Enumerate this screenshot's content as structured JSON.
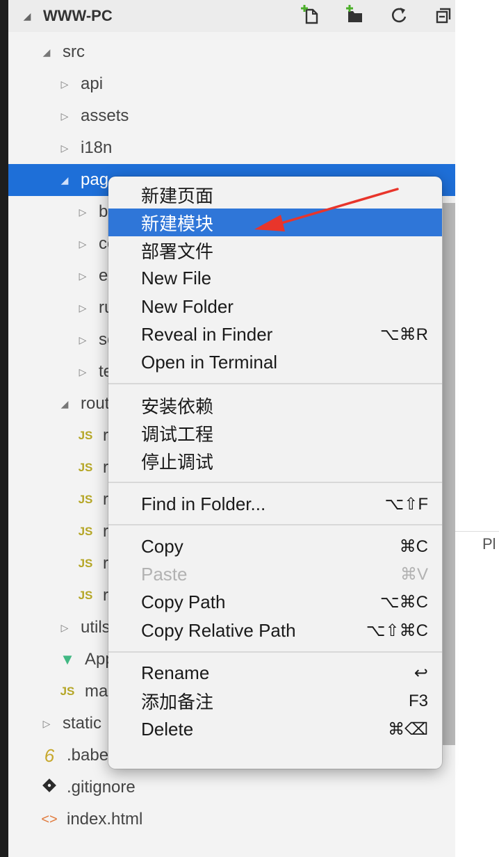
{
  "explorer": {
    "project_title": "WWW-PC",
    "header_icons": [
      "new-file-icon",
      "new-folder-icon",
      "refresh-icon",
      "collapse-all-icon"
    ],
    "tree": [
      {
        "label": "src",
        "twist": "◢",
        "icon": "",
        "depth": 1,
        "selected": false
      },
      {
        "label": "api",
        "twist": "▷",
        "icon": "",
        "depth": 2,
        "selected": false
      },
      {
        "label": "assets",
        "twist": "▷",
        "icon": "",
        "depth": 2,
        "selected": false
      },
      {
        "label": "i18n",
        "twist": "▷",
        "icon": "",
        "depth": 2,
        "selected": false
      },
      {
        "label": "pag",
        "twist": "◢",
        "icon": "",
        "depth": 2,
        "selected": true
      },
      {
        "label": "bu",
        "twist": "▷",
        "icon": "",
        "depth": 3,
        "selected": false
      },
      {
        "label": "co",
        "twist": "▷",
        "icon": "",
        "depth": 3,
        "selected": false
      },
      {
        "label": "ex",
        "twist": "▷",
        "icon": "",
        "depth": 3,
        "selected": false
      },
      {
        "label": "ru",
        "twist": "▷",
        "icon": "",
        "depth": 3,
        "selected": false
      },
      {
        "label": "sc",
        "twist": "▷",
        "icon": "",
        "depth": 3,
        "selected": false
      },
      {
        "label": "te",
        "twist": "▷",
        "icon": "",
        "depth": 3,
        "selected": false
      },
      {
        "label": "rout",
        "twist": "◢",
        "icon": "",
        "depth": 2,
        "selected": false
      },
      {
        "label": "ro",
        "twist": "",
        "icon": "JS",
        "depth": 3,
        "selected": false
      },
      {
        "label": "ro",
        "twist": "",
        "icon": "JS",
        "depth": 3,
        "selected": false
      },
      {
        "label": "ro",
        "twist": "",
        "icon": "JS",
        "depth": 3,
        "selected": false
      },
      {
        "label": "ro",
        "twist": "",
        "icon": "JS",
        "depth": 3,
        "selected": false
      },
      {
        "label": "ro",
        "twist": "",
        "icon": "JS",
        "depth": 3,
        "selected": false
      },
      {
        "label": "ro",
        "twist": "",
        "icon": "JS",
        "depth": 3,
        "selected": false
      },
      {
        "label": "utils",
        "twist": "▷",
        "icon": "",
        "depth": 2,
        "selected": false
      },
      {
        "label": "App",
        "twist": "",
        "icon": "V",
        "depth": 2,
        "selected": false
      },
      {
        "label": "mai",
        "twist": "",
        "icon": "JS",
        "depth": 2,
        "selected": false
      },
      {
        "label": "static",
        "twist": "▷",
        "icon": "",
        "depth": 1,
        "selected": false
      },
      {
        "label": ".babelrc",
        "twist": "",
        "icon": "6",
        "depth": 1,
        "selected": false
      },
      {
        "label": ".gitignore",
        "twist": "",
        "icon": "git",
        "depth": 1,
        "selected": false
      },
      {
        "label": "index.html",
        "twist": "",
        "icon": "<>",
        "depth": 1,
        "selected": false
      }
    ]
  },
  "right_pane": {
    "text": "Pl"
  },
  "context_menu": {
    "groups": [
      [
        {
          "label": "新建页面",
          "shortcut": "",
          "active": false,
          "disabled": false
        },
        {
          "label": "新建模块",
          "shortcut": "",
          "active": true,
          "disabled": false
        },
        {
          "label": "部署文件",
          "shortcut": "",
          "active": false,
          "disabled": false
        },
        {
          "label": "New File",
          "shortcut": "",
          "active": false,
          "disabled": false
        },
        {
          "label": "New Folder",
          "shortcut": "",
          "active": false,
          "disabled": false
        },
        {
          "label": "Reveal in Finder",
          "shortcut": "⌥⌘R",
          "active": false,
          "disabled": false
        },
        {
          "label": "Open in Terminal",
          "shortcut": "",
          "active": false,
          "disabled": false
        }
      ],
      [
        {
          "label": "安装依赖",
          "shortcut": "",
          "active": false,
          "disabled": false
        },
        {
          "label": "调试工程",
          "shortcut": "",
          "active": false,
          "disabled": false
        },
        {
          "label": "停止调试",
          "shortcut": "",
          "active": false,
          "disabled": false
        }
      ],
      [
        {
          "label": "Find in Folder...",
          "shortcut": "⌥⇧F",
          "active": false,
          "disabled": false
        }
      ],
      [
        {
          "label": "Copy",
          "shortcut": "⌘C",
          "active": false,
          "disabled": false
        },
        {
          "label": "Paste",
          "shortcut": "⌘V",
          "active": false,
          "disabled": true
        },
        {
          "label": "Copy Path",
          "shortcut": "⌥⌘C",
          "active": false,
          "disabled": false
        },
        {
          "label": "Copy Relative Path",
          "shortcut": "⌥⇧⌘C",
          "active": false,
          "disabled": false
        }
      ],
      [
        {
          "label": "Rename",
          "shortcut": "↩",
          "active": false,
          "disabled": false
        },
        {
          "label": "添加备注",
          "shortcut": "F3",
          "active": false,
          "disabled": false
        },
        {
          "label": "Delete",
          "shortcut": "⌘⌫",
          "active": false,
          "disabled": false
        }
      ]
    ]
  },
  "colors": {
    "selection": "#1e6fd8",
    "menu_highlight": "#2f76d8",
    "annotation_arrow": "#e8352b"
  },
  "annotation": {
    "arrow_target": "新建模块"
  }
}
